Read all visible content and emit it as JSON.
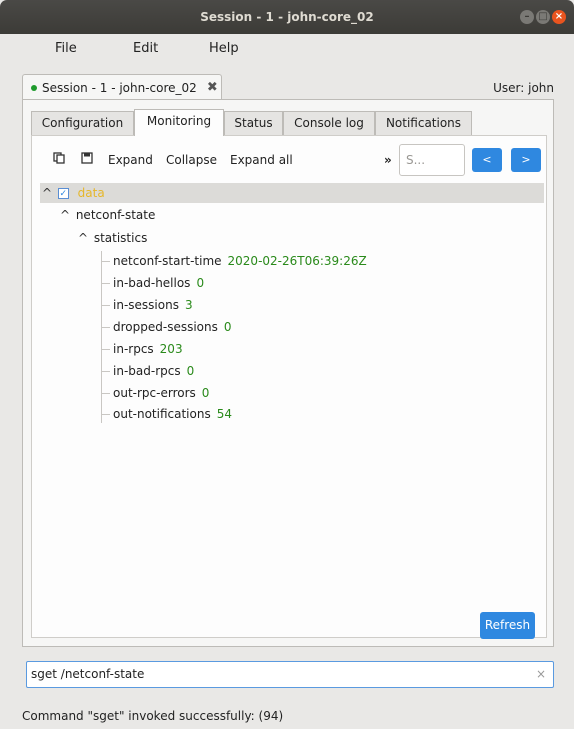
{
  "window": {
    "title": "Session - 1 - john-core_02"
  },
  "menu": [
    "File",
    "Edit",
    "Help"
  ],
  "session_tab": {
    "label": "Session - 1 - john-core_02",
    "close": "✖"
  },
  "user_label": "User: john",
  "tabs": [
    "Configuration",
    "Monitoring",
    "Status",
    "Console log",
    "Notifications"
  ],
  "active_tab": "Monitoring",
  "toolbar": {
    "expand": "Expand",
    "collapse": "Collapse",
    "expand_all": "Expand all",
    "more": "»",
    "search_placeholder": "S...",
    "prev": "<",
    "next": ">"
  },
  "tree": {
    "root": "data",
    "child": "netconf-state",
    "group": "statistics",
    "leaves": [
      {
        "name": "netconf-start-time",
        "value": "2020-02-26T06:39:26Z"
      },
      {
        "name": "in-bad-hellos",
        "value": "0"
      },
      {
        "name": "in-sessions",
        "value": "3"
      },
      {
        "name": "dropped-sessions",
        "value": "0"
      },
      {
        "name": "in-rpcs",
        "value": "203"
      },
      {
        "name": "in-bad-rpcs",
        "value": "0"
      },
      {
        "name": "out-rpc-errors",
        "value": "0"
      },
      {
        "name": "out-notifications",
        "value": "54"
      }
    ]
  },
  "refresh_label": "Refresh",
  "command": {
    "value": "sget /netconf-state",
    "clear": "×"
  },
  "status": "Command \"sget\" invoked successfully: (94)",
  "colors": {
    "accent": "#2f88e0",
    "value_green": "#2a8a1b",
    "selected_root": "#e6b72a"
  }
}
